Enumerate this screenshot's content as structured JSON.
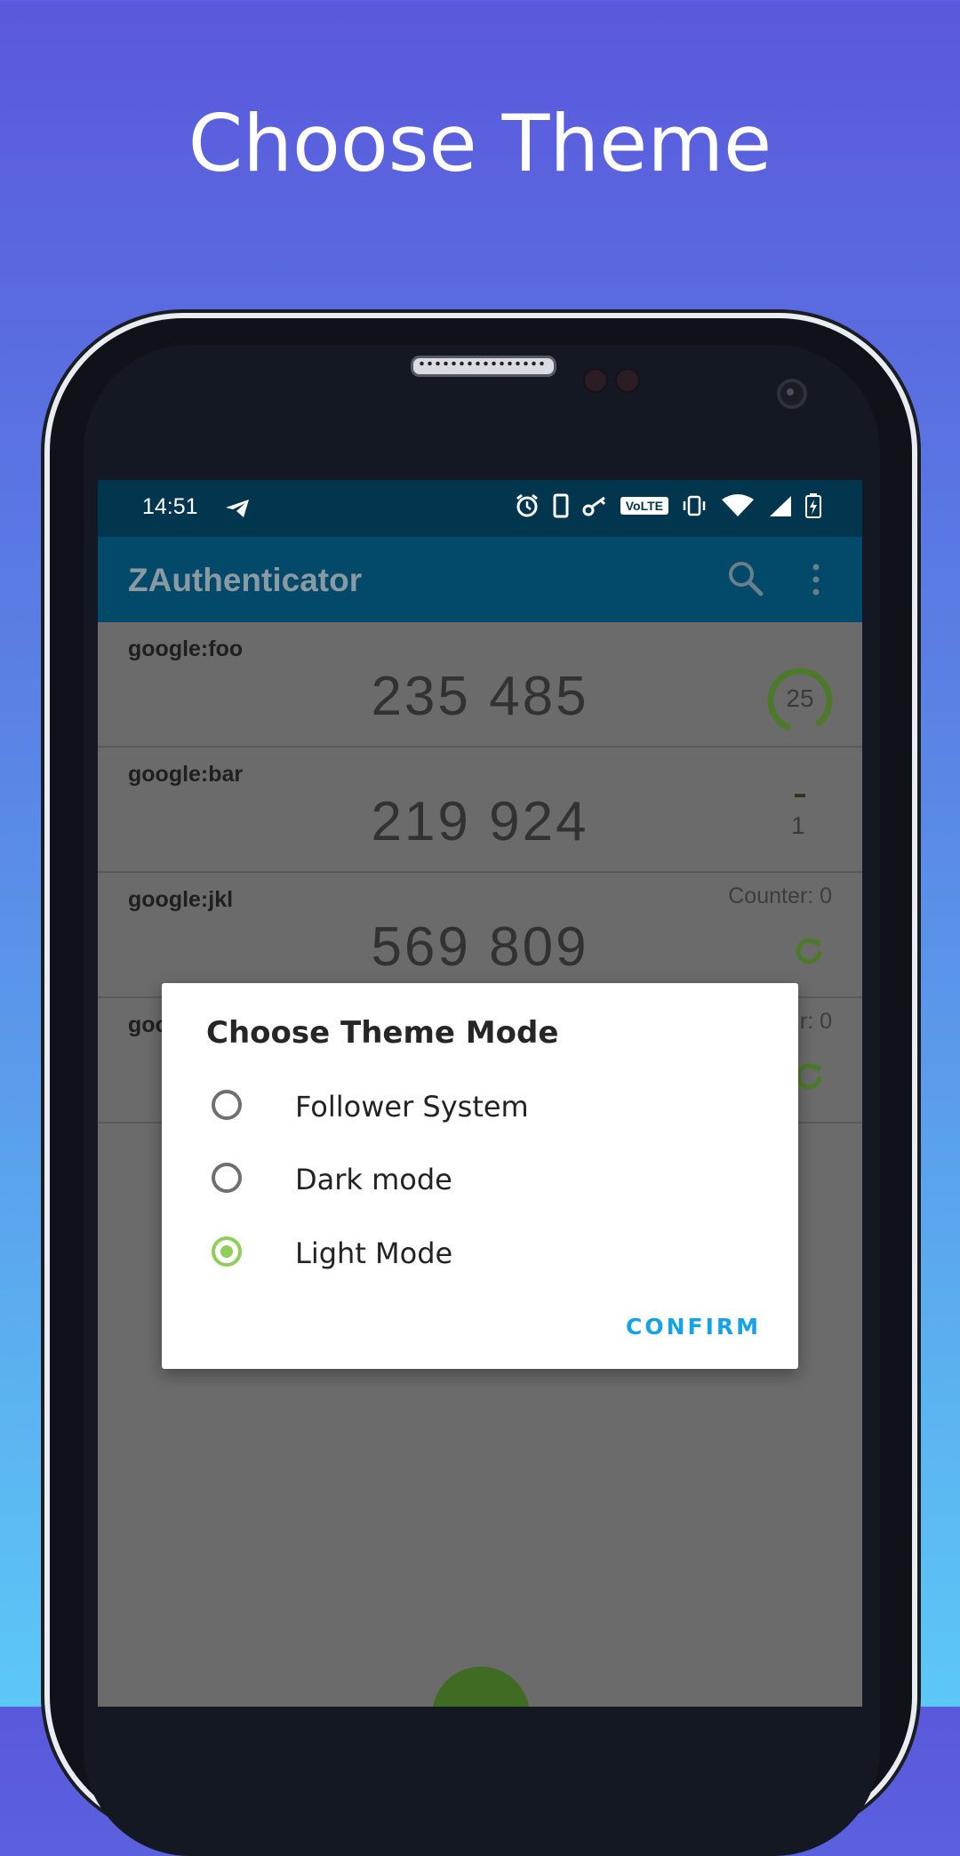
{
  "headline": "Choose Theme",
  "status_bar": {
    "time": "14:51",
    "volte_label": "VoLTE"
  },
  "app_bar": {
    "title": "ZAuthenticator"
  },
  "accounts": [
    {
      "label": "google:foo",
      "code": "235 485",
      "type": "totp",
      "timer_value": "25"
    },
    {
      "label": "google:bar",
      "code": "219 924",
      "type": "totp",
      "timer_value": "1"
    },
    {
      "label": "google:jkl",
      "code": "569 809",
      "type": "hotp",
      "counter_text": "Counter: 0"
    },
    {
      "label": "goo",
      "code": "",
      "type": "hotp",
      "counter_text": "r: 0"
    }
  ],
  "dialog": {
    "title": "Choose Theme Mode",
    "options": [
      {
        "label": "Follower System",
        "selected": false
      },
      {
        "label": "Dark mode",
        "selected": false
      },
      {
        "label": "Light Mode",
        "selected": true
      }
    ],
    "confirm_label": "CONFIRM"
  },
  "colors": {
    "accent_green": "#8fce5a",
    "confirm_blue": "#16a3e6",
    "appbar": "#03496a",
    "statusbar": "#02364f"
  }
}
